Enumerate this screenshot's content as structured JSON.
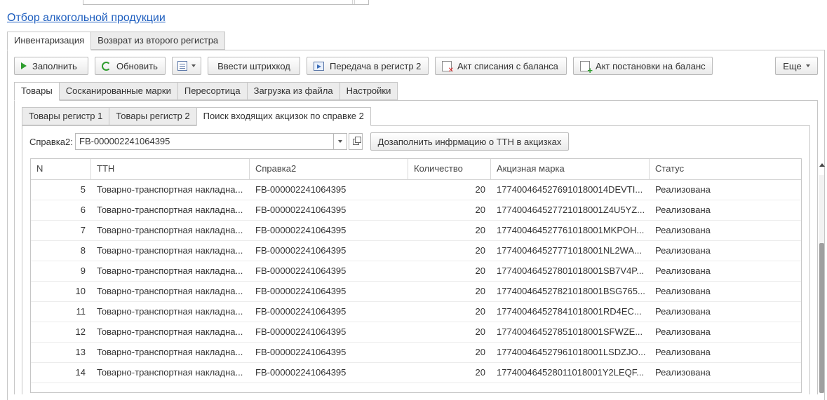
{
  "page_title": "Отбор алкогольной продукции",
  "main_tabs": [
    {
      "label": "Инвентаризация",
      "active": true
    },
    {
      "label": "Возврат из второго регистра",
      "active": false
    }
  ],
  "toolbar": {
    "fill": "Заполнить",
    "refresh": "Обновить",
    "barcode": "Ввести штрихкод",
    "transfer": "Передача в регистр 2",
    "writeoff": "Акт списания с баланса",
    "register": "Акт постановки на баланс",
    "more": "Еще"
  },
  "sub_tabs": [
    {
      "label": "Товары",
      "active": true
    },
    {
      "label": "Сосканированные марки",
      "active": false
    },
    {
      "label": "Пересортица",
      "active": false
    },
    {
      "label": "Загрузка из файла",
      "active": false
    },
    {
      "label": "Настройки",
      "active": false
    }
  ],
  "inner_tabs": [
    {
      "label": "Товары регистр 1",
      "active": false
    },
    {
      "label": "Товары регистр 2",
      "active": false
    },
    {
      "label": "Поиск входящих акцизок по справке 2",
      "active": true
    }
  ],
  "certificate": {
    "label": "Справка2:",
    "value": "FB-000002241064395",
    "fill_button": "Дозаполнить инфрмацию о ТТН в акцизках"
  },
  "table": {
    "columns": [
      "N",
      "ТТН",
      "Справка2",
      "Количество",
      "Акцизная марка",
      "Статус"
    ],
    "rows": [
      [
        "5",
        "Товарно-транспортная накладна...",
        "FB-000002241064395",
        "20",
        "17740046452769101800​14DEVTI...",
        "Реализована"
      ],
      [
        "6",
        "Товарно-транспортная накладна...",
        "FB-000002241064395",
        "20",
        "177400464527721018001Z4U5YZ...",
        "Реализована"
      ],
      [
        "7",
        "Товарно-транспортная накладна...",
        "FB-000002241064395",
        "20",
        "177400464527761018001MKPOH...",
        "Реализована"
      ],
      [
        "8",
        "Товарно-транспортная накладна...",
        "FB-000002241064395",
        "20",
        "177400464527771018001NL2WA...",
        "Реализована"
      ],
      [
        "9",
        "Товарно-транспортная накладна...",
        "FB-000002241064395",
        "20",
        "177400464527801018001SB7V4P...",
        "Реализована"
      ],
      [
        "10",
        "Товарно-транспортная накладна...",
        "FB-000002241064395",
        "20",
        "177400464527821018001BSG765...",
        "Реализована"
      ],
      [
        "11",
        "Товарно-транспортная накладна...",
        "FB-000002241064395",
        "20",
        "177400464527841018001RD4EC...",
        "Реализована"
      ],
      [
        "12",
        "Товарно-транспортная накладна...",
        "FB-000002241064395",
        "20",
        "177400464527851018001SFWZE...",
        "Реализована"
      ],
      [
        "13",
        "Товарно-транспортная накладна...",
        "FB-000002241064395",
        "20",
        "177400464527961018001LSDZJO...",
        "Реализована"
      ],
      [
        "14",
        "Товарно-транспортная накладна...",
        "FB-000002241064395",
        "20",
        "177400464528011018001Y2LEQF...",
        "Реализована"
      ]
    ]
  },
  "colors": {
    "link": "#1f5fbf",
    "accent_green": "#2e9d2e"
  }
}
